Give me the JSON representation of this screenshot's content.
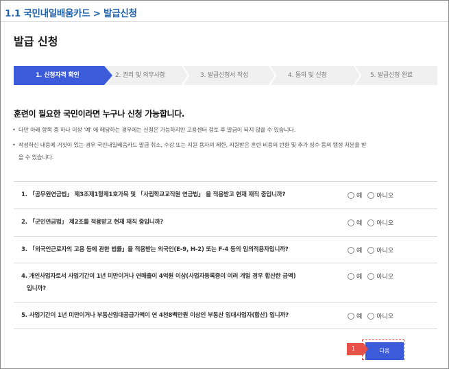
{
  "header": {
    "section_title": "1.1 국민내일배움카드 > 발급신청",
    "page_title": "발급 신청"
  },
  "steps": [
    {
      "label": "1. 신청자격 확인",
      "active": true
    },
    {
      "label": "2. 권리 및 의무사항",
      "active": false
    },
    {
      "label": "3. 발급신청서 작성",
      "active": false
    },
    {
      "label": "4. 동의 및 신청",
      "active": false
    },
    {
      "label": "5. 발급신청 완료",
      "active": false
    }
  ],
  "intro": {
    "headline": "훈련이 필요한 국민이라면 누구나 신청 가능합니다.",
    "notes": [
      {
        "bullet": "•",
        "line1": "다만 아래 항목 중 하나 이상 '예' 에 해당하는 경우에는 신청은 가능하지만 고용센터 검토 후 발급이 되지 않을 수 있습니다.",
        "line2": ""
      },
      {
        "bullet": "•",
        "line1": "작성하신 내용에 거짓이 있는 경우 국민내일배움카드 발급 취소, 수강 또는 지원 용자의 제한, 지원받은 훈련 비용의 반환 및 추가 징수 등의 행정 처분을 받",
        "line2": "을 수 있습니다."
      }
    ]
  },
  "questions": [
    {
      "line1": "1. 「공무원연금법」 제3조제1항제1호가목 및 「사립학교교직원 연금법」 을 적용받고 현재 재직 중입니까?",
      "line2": ""
    },
    {
      "line1": "2. 「군인연금법」 제2조를 적용받고 현재 재직 중입니까?",
      "line2": ""
    },
    {
      "line1": "3. 「외국인근로자의 고용 등에 관한 법률」을 적용받는 외국인(E-9, H-2) 또는 F-4 등의 임의적용자입니까?",
      "line2": ""
    },
    {
      "line1": "4. 개인사업자로서 사업기간이 1년 미만이거나 연매출이 4억원 이상(사업자등록증이 여러 개일 경우 합산한 금액)",
      "line2": "입니까?"
    },
    {
      "line1": "5. 사업기간이 1년 미만이거나 부동산임대공급가액이 연 4천8백만원 이상인 부동산 임대사업자(합산) 입니까?",
      "line2": ""
    }
  ],
  "options": {
    "yes": "예",
    "no": "아니오"
  },
  "footer": {
    "next_label": "다음",
    "marker_label": "1"
  },
  "colors": {
    "accent": "#3b5bdb",
    "title": "#1f5fa8",
    "marker": "#e8504a"
  }
}
